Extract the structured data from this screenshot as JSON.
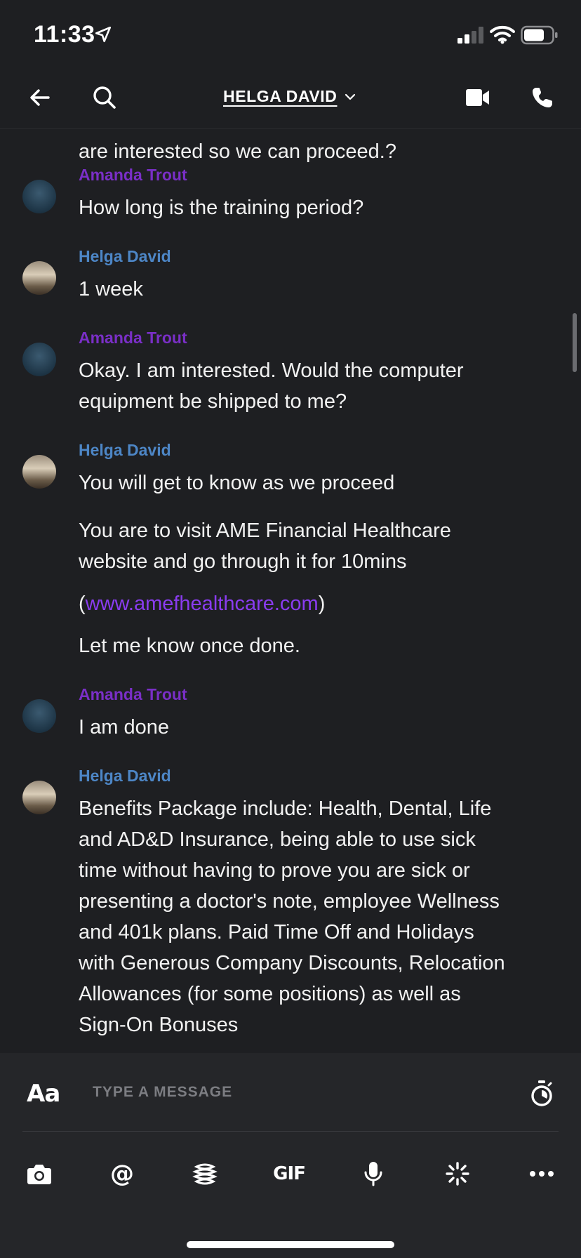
{
  "status_bar": {
    "time": "11:33"
  },
  "header": {
    "title": "HELGA DAVID"
  },
  "messages": {
    "partial_top": "are interested so we can proceed.?",
    "m1": {
      "sender": "Amanda Trout",
      "text": "How long is the training period?"
    },
    "m2": {
      "sender": "Helga David",
      "text": "1 week"
    },
    "m3": {
      "sender": "Amanda Trout",
      "line1": "Okay. I am interested. Would the computer",
      "line2": "equipment be shipped to me?"
    },
    "m4": {
      "sender": "Helga David",
      "text1": "You will get to know as we proceed",
      "text2_line1": "You are to visit AME Financial Healthcare",
      "text2_line2": "website and go through it for 10mins",
      "link_open": "(",
      "link": "www.amefhealthcare.com",
      "link_close": ")",
      "text3": "Let me know once done."
    },
    "m5": {
      "sender": "Amanda Trout",
      "text": "I am done"
    },
    "m6": {
      "sender": "Helga David",
      "lines": [
        "Benefits Package include: Health, Dental, Life",
        "and AD&D Insurance, being able to use sick",
        "time without having to prove you are sick or",
        "presenting a doctor's note, employee Wellness",
        "and 401k plans. Paid Time Off and Holidays",
        "with Generous Company Discounts, Relocation",
        "Allowances (for some positions) as well as",
        "Sign-On Bonuses"
      ]
    }
  },
  "composer": {
    "aa_label": "Aa",
    "placeholder": "TYPE A MESSAGE",
    "gif_label": "GIF",
    "at_label": "@"
  },
  "colors": {
    "background": "#1e1f22",
    "amanda_name": "#7a2fc7",
    "helga_name": "#4d86c6",
    "link": "#8a3cf0"
  }
}
